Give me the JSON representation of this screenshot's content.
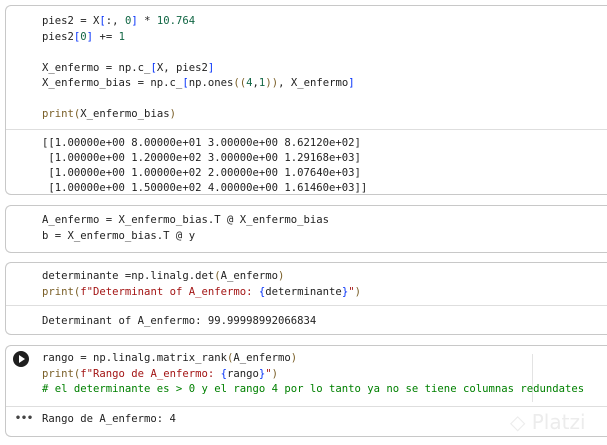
{
  "cells": [
    {
      "code": [
        [
          [
            "pies2 = X",
            "pl"
          ],
          [
            "[",
            "br"
          ],
          [
            ":, ",
            "pl"
          ],
          [
            "0",
            "num"
          ],
          [
            "]",
            "br"
          ],
          [
            " * ",
            "pl"
          ],
          [
            "10.764",
            "num"
          ]
        ],
        [
          [
            "pies2",
            "pl"
          ],
          [
            "[",
            "br"
          ],
          [
            "0",
            "num"
          ],
          [
            "]",
            "br"
          ],
          [
            " += ",
            "pl"
          ],
          [
            "1",
            "num"
          ]
        ],
        [],
        [
          [
            "X_enfermo = np.c_",
            "pl"
          ],
          [
            "[",
            "br"
          ],
          [
            "X, pies2",
            "pl"
          ],
          [
            "]",
            "br"
          ]
        ],
        [
          [
            "X_enfermo_bias = np.c_",
            "pl"
          ],
          [
            "[",
            "br"
          ],
          [
            "np.ones",
            "pl"
          ],
          [
            "((",
            "fn"
          ],
          [
            "4",
            "num"
          ],
          [
            ",",
            "pl"
          ],
          [
            "1",
            "num"
          ],
          [
            "))",
            "fn"
          ],
          [
            ", X_enfermo",
            "pl"
          ],
          [
            "]",
            "br"
          ]
        ],
        [],
        [
          [
            "print",
            "fn"
          ],
          [
            "(",
            "fn"
          ],
          [
            "X_enfermo_bias",
            "pl"
          ],
          [
            ")",
            "fn"
          ]
        ]
      ],
      "output": [
        "[[1.00000e+00 8.00000e+01 3.00000e+00 8.62120e+02]",
        " [1.00000e+00 1.20000e+02 3.00000e+00 1.29168e+03]",
        " [1.00000e+00 1.00000e+02 2.00000e+00 1.07640e+03]",
        " [1.00000e+00 1.50000e+02 4.00000e+00 1.61460e+03]]"
      ]
    },
    {
      "code": [
        [
          [
            "A_enfermo = X_enfermo_bias.T @ X_enfermo_bias",
            "pl"
          ]
        ],
        [
          [
            "b = X_enfermo_bias.T @ y",
            "pl"
          ]
        ]
      ],
      "output": []
    },
    {
      "code": [
        [
          [
            "determinante =np.linalg.det",
            "pl"
          ],
          [
            "(",
            "fn"
          ],
          [
            "A_enfermo",
            "pl"
          ],
          [
            ")",
            "fn"
          ]
        ],
        [
          [
            "print",
            "fn"
          ],
          [
            "(",
            "fn"
          ],
          [
            "f\"Determinant of A_enfermo: ",
            "str"
          ],
          [
            "{",
            "br"
          ],
          [
            "determinante",
            "pl"
          ],
          [
            "}",
            "br"
          ],
          [
            "\"",
            "str"
          ],
          [
            ")",
            "fn"
          ]
        ]
      ],
      "output": [
        "Determinant of A_enfermo: 99.99998992066834"
      ]
    },
    {
      "code": [
        [
          [
            "rango = np.linalg.matrix_rank",
            "pl"
          ],
          [
            "(",
            "fn"
          ],
          [
            "A_enfermo",
            "pl"
          ],
          [
            ")",
            "fn"
          ]
        ],
        [
          [
            "print",
            "fn"
          ],
          [
            "(",
            "fn"
          ],
          [
            "f\"Rango de A_enfermo: ",
            "str"
          ],
          [
            "{",
            "br"
          ],
          [
            "rango",
            "pl"
          ],
          [
            "}",
            "br"
          ],
          [
            "\"",
            "str"
          ],
          [
            ")",
            "fn"
          ]
        ],
        [
          [
            "# el determinante es > 0 y el rango 4 por lo tanto ya no se tiene columnas redundates",
            "cm"
          ]
        ]
      ],
      "output": [
        "Rango de A_enfermo: 4"
      ]
    }
  ],
  "output_dots": "•••",
  "watermark": "Platzi"
}
